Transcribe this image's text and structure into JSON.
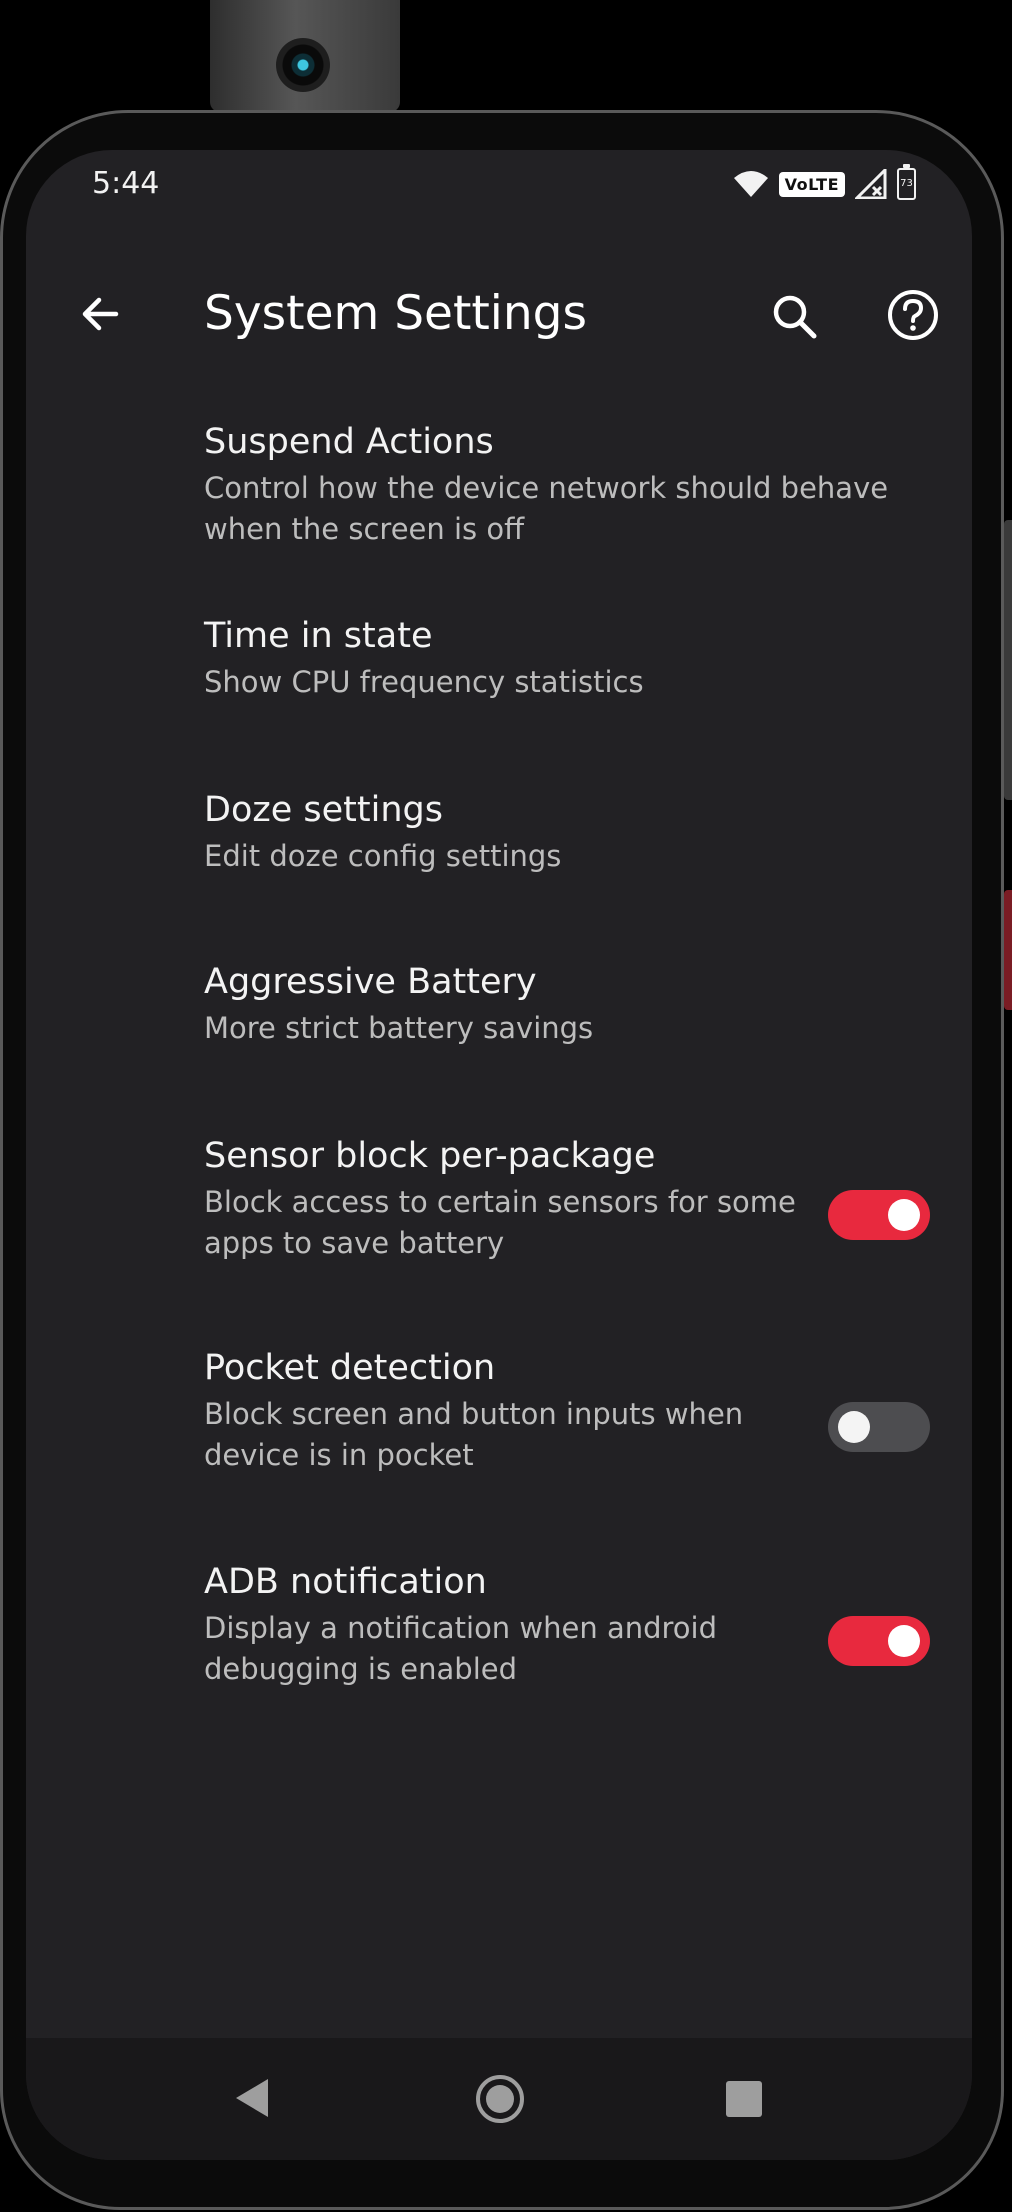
{
  "status_bar": {
    "time": "5:44",
    "volte_label": "VoLTE",
    "battery_level": "73",
    "icons": [
      "wifi-icon",
      "volte-icon",
      "signal-icon",
      "battery-icon"
    ]
  },
  "app_bar": {
    "title": "System Settings",
    "icons": [
      "back-arrow-icon",
      "search-icon",
      "help-icon"
    ]
  },
  "settings": [
    {
      "title": "Suspend Actions",
      "summary": "Control how the device network should behave when the screen is off"
    },
    {
      "title": "Time in state",
      "summary": "Show CPU frequency statistics"
    },
    {
      "title": "Doze settings",
      "summary": "Edit doze config settings"
    },
    {
      "title": "Aggressive Battery",
      "summary": "More strict battery savings"
    },
    {
      "title": "Sensor block per-package",
      "summary": "Block access to certain sensors for some apps to save battery",
      "toggle": true
    },
    {
      "title": "Pocket detection",
      "summary": "Block screen and button inputs when device is in pocket",
      "toggle": false
    },
    {
      "title": "ADB notification",
      "summary": "Display a notification when android debugging is enabled",
      "toggle": true
    }
  ],
  "nav_bar": {
    "icons": [
      "nav-back-icon",
      "nav-home-icon",
      "nav-recents-icon"
    ]
  },
  "colors": {
    "background": "#222124",
    "toggle_on": "#e8293e",
    "toggle_off": "#4d4d50",
    "title_text": "#f3f3f3",
    "summary_text": "#bdbdbd"
  }
}
